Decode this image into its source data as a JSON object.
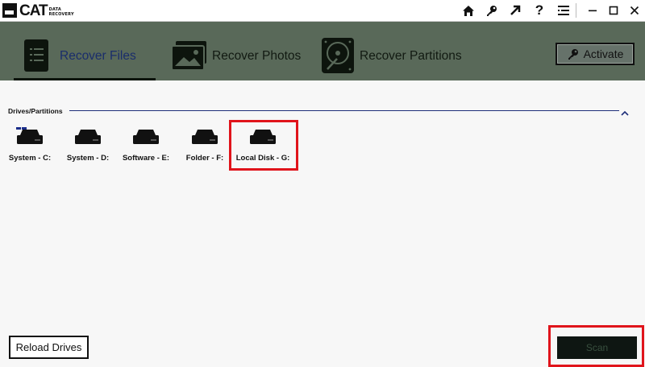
{
  "app": {
    "logo_text": "CAT",
    "logo_sub_1": "DATA",
    "logo_sub_2": "RECOVERY"
  },
  "titlebar": {
    "icons": [
      "home-icon",
      "key-icon",
      "external-arrow-icon",
      "help-icon",
      "menu-icon",
      "minimize-icon",
      "maximize-icon",
      "close-icon"
    ]
  },
  "nav": {
    "tabs": [
      {
        "label": "Recover Files",
        "icon": "document-icon",
        "active": true
      },
      {
        "label": "Recover Photos",
        "icon": "photos-icon",
        "active": false
      },
      {
        "label": "Recover Partitions",
        "icon": "hard-disk-icon",
        "active": false
      }
    ],
    "activate_label": "Activate"
  },
  "drives": {
    "section_title": "Drives/Partitions",
    "items": [
      {
        "label": "System - C:",
        "icon": "system-drive-icon"
      },
      {
        "label": "System - D:",
        "icon": "drive-icon"
      },
      {
        "label": "Software - E:",
        "icon": "drive-icon"
      },
      {
        "label": "Folder - F:",
        "icon": "drive-icon"
      },
      {
        "label": "Local Disk - G:",
        "icon": "drive-icon",
        "highlighted": true
      }
    ]
  },
  "footer": {
    "reload_label": "Reload Drives",
    "scan_label": "Scan"
  },
  "colors": {
    "header_bg": "#596959",
    "active_tab_text": "#1a2d6b",
    "highlight": "#e0141b",
    "scan_bg": "#0e1612"
  }
}
